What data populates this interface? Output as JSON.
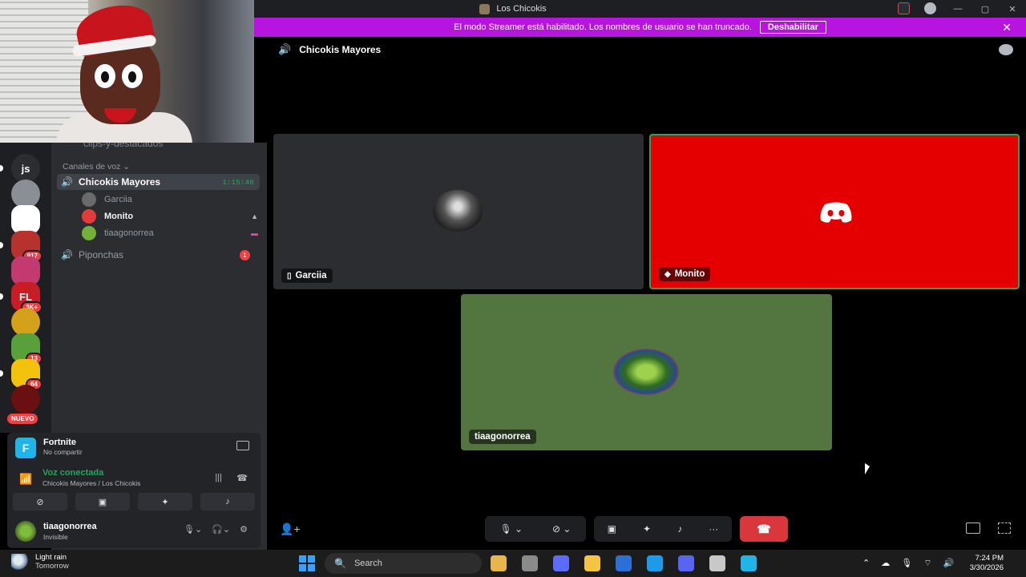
{
  "window": {
    "title": "Los Chicokis"
  },
  "banner": {
    "text": "El modo Streamer está habilitado. Los nombres de usuario se han truncado.",
    "button": "Deshabilitar",
    "close": "✕"
  },
  "servers": [
    {
      "label": "js",
      "color": "#2b2d31",
      "badge": ""
    },
    {
      "label": "",
      "color": "#8a8f95",
      "badge": ""
    },
    {
      "label": "",
      "color": "#ffffff",
      "badge": ""
    },
    {
      "label": "",
      "color": "#b8322d",
      "badge": "917"
    },
    {
      "label": "",
      "color": "#c33a70",
      "badge": ""
    },
    {
      "label": "FL",
      "color": "#c81d24",
      "badge": "3K+"
    },
    {
      "label": "",
      "color": "#d4a21a",
      "badge": ""
    },
    {
      "label": "",
      "color": "#5aa03a",
      "badge": "13"
    },
    {
      "label": "",
      "color": "#f2c20c",
      "badge": "64"
    },
    {
      "label": "",
      "color": "#6a1010",
      "badge": ""
    }
  ],
  "rail_new": "NUEVO",
  "sidebar": {
    "cut_channel": "clips-y-destacados",
    "category": "Canales de voz ⌄",
    "channels": [
      {
        "name": "Chicokis Mayores",
        "timer": "1:15:46"
      },
      {
        "name": "Piponchas",
        "count": "1"
      }
    ],
    "members": [
      {
        "name": "Garciia",
        "av_color": "#6a6a6a",
        "icon": ""
      },
      {
        "name": "Monito",
        "av_color": "#e23b3b",
        "icon": "▲"
      },
      {
        "name": "tiaagonorrea",
        "av_color": "#74b13a",
        "icon": "▬"
      }
    ]
  },
  "activity": {
    "game": "Fortnite",
    "game_icon": "F",
    "game_sub": "No compartir",
    "voice_title": "Voz conectada",
    "voice_sub": "Chicokis Mayores / Los Chicokis",
    "user_name": "tiaagonorrea",
    "user_status": "Invisible"
  },
  "call": {
    "channel": "Chicokis Mayores",
    "tiles": [
      {
        "name": "Garciia",
        "icon": "▯"
      },
      {
        "name": "Monito",
        "icon": "◆"
      },
      {
        "name": "tiaagonorrea",
        "icon": ""
      }
    ],
    "controls": {
      "mic": "🎙 ⌄",
      "camera": "⊘ ⌄",
      "share": "▣",
      "activities": "✦",
      "soundboard": "♪",
      "more": "···",
      "hangup": "☎"
    }
  },
  "taskbar": {
    "weather_title": "Light rain",
    "weather_sub": "Tomorrow",
    "search_placeholder": "Search",
    "time": "7:24 PM",
    "date": "3/30/2026",
    "app_colors": [
      "#e8b54a",
      "#8a8a8a",
      "#5c6bff",
      "#f5c542",
      "#2b6fd9",
      "#1e9be8",
      "#5865f2",
      "#c8c8c8",
      "#1fb5e8"
    ]
  }
}
